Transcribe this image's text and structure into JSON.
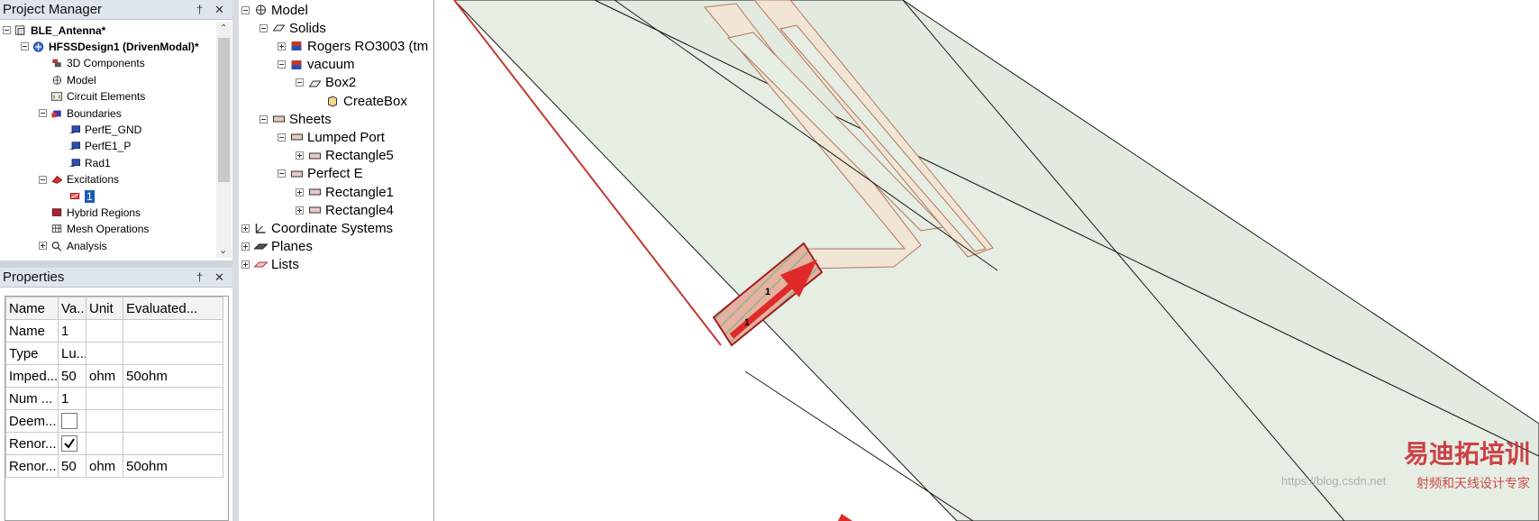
{
  "project_manager": {
    "title": "Project Manager",
    "pin": "†",
    "close": "✕",
    "tree": [
      {
        "label": "BLE_Antenna*",
        "bold": true,
        "level": 0,
        "expander": "minus",
        "icon": "project-icon"
      },
      {
        "label": "HFSSDesign1 (DrivenModal)*",
        "bold": true,
        "level": 1,
        "expander": "minus",
        "icon": "hfss-design-icon"
      },
      {
        "label": "3D Components",
        "level": 2,
        "expander": "none",
        "icon": "components-3d-icon"
      },
      {
        "label": "Model",
        "level": 2,
        "expander": "none",
        "icon": "model-icon"
      },
      {
        "label": "Circuit Elements",
        "level": 2,
        "expander": "none",
        "icon": "circuit-elements-icon"
      },
      {
        "label": "Boundaries",
        "level": 2,
        "expander": "minus",
        "icon": "boundaries-icon"
      },
      {
        "label": "PerfE_GND",
        "level": 3,
        "expander": "none",
        "icon": "boundary-item-icon"
      },
      {
        "label": "PerfE1_P",
        "level": 3,
        "expander": "none",
        "icon": "boundary-item-icon"
      },
      {
        "label": "Rad1",
        "level": 3,
        "expander": "none",
        "icon": "boundary-item-icon"
      },
      {
        "label": "Excitations",
        "level": 2,
        "expander": "minus",
        "icon": "excitations-icon"
      },
      {
        "label": "1",
        "level": 3,
        "expander": "none",
        "icon": "excitation-port-icon",
        "selected": true
      },
      {
        "label": "Hybrid Regions",
        "level": 2,
        "expander": "none",
        "icon": "hybrid-regions-icon"
      },
      {
        "label": "Mesh Operations",
        "level": 2,
        "expander": "none",
        "icon": "mesh-operations-icon"
      },
      {
        "label": "Analysis",
        "level": 2,
        "expander": "plus",
        "icon": "analysis-icon"
      }
    ]
  },
  "properties": {
    "title": "Properties",
    "pin": "†",
    "close": "✕",
    "columns": [
      "Name",
      "Va...",
      "Unit",
      "Evaluated..."
    ],
    "rows": [
      {
        "name": "Name",
        "value": "1",
        "unit": "",
        "evaluated": ""
      },
      {
        "name": "Type",
        "value": "Lu...",
        "unit": "",
        "evaluated": ""
      },
      {
        "name": "Imped...",
        "value": "50",
        "unit": "ohm",
        "evaluated": "50ohm"
      },
      {
        "name": "Num ...",
        "value": "1",
        "unit": "",
        "evaluated": ""
      },
      {
        "name": "Deem...",
        "checkbox": false,
        "unit": "",
        "evaluated": ""
      },
      {
        "name": "Renor...",
        "checkbox": true,
        "unit": "",
        "evaluated": ""
      },
      {
        "name": "Renor...",
        "value": "50",
        "unit": "ohm",
        "evaluated": "50ohm"
      }
    ]
  },
  "model_tree": [
    {
      "label": "Model",
      "level": 0,
      "expander": "minus",
      "icon": "model-icon"
    },
    {
      "label": "Solids",
      "level": 1,
      "expander": "minus",
      "icon": "solids-icon"
    },
    {
      "label": "Rogers RO3003 (tm",
      "level": 2,
      "expander": "plus",
      "icon": "material-rogers-icon"
    },
    {
      "label": "vacuum",
      "level": 2,
      "expander": "minus",
      "icon": "material-vacuum-icon"
    },
    {
      "label": "Box2",
      "level": 3,
      "expander": "minus",
      "icon": "box-icon"
    },
    {
      "label": "CreateBox",
      "level": 4,
      "expander": "none",
      "icon": "create-box-icon"
    },
    {
      "label": "Sheets",
      "level": 1,
      "expander": "minus",
      "icon": "sheets-icon"
    },
    {
      "label": "Lumped Port",
      "level": 2,
      "expander": "minus",
      "icon": "sheet-group-icon"
    },
    {
      "label": "Rectangle5",
      "level": 3,
      "expander": "plus",
      "icon": "rectangle-icon"
    },
    {
      "label": "Perfect E",
      "level": 2,
      "expander": "minus",
      "icon": "sheet-group-icon"
    },
    {
      "label": "Rectangle1",
      "level": 3,
      "expander": "plus",
      "icon": "rectangle-icon"
    },
    {
      "label": "Rectangle4",
      "level": 3,
      "expander": "plus",
      "icon": "rectangle-icon"
    },
    {
      "label": "Coordinate Systems",
      "level": 0,
      "expander": "plus",
      "icon": "coordinate-systems-icon"
    },
    {
      "label": "Planes",
      "level": 0,
      "expander": "plus",
      "icon": "planes-icon"
    },
    {
      "label": "Lists",
      "level": 0,
      "expander": "plus",
      "icon": "lists-icon"
    }
  ],
  "viewport": {
    "port_label_a": "1",
    "port_label_b": "1",
    "watermark_brand": "易迪拓培训",
    "watermark_sub": "射频和天线设计专家",
    "watermark_url": "https://blog.csdn.net"
  },
  "colors": {
    "substrate": "#e6ede3",
    "trace": "#f1e6d6",
    "trace_edge": "#b5755a",
    "port_fill": "#e6b1a1",
    "port_hatch": "#8cb78c",
    "arrow": "#e02a2a",
    "selection": "#1a5fb4",
    "watermark": "#c8242a"
  }
}
